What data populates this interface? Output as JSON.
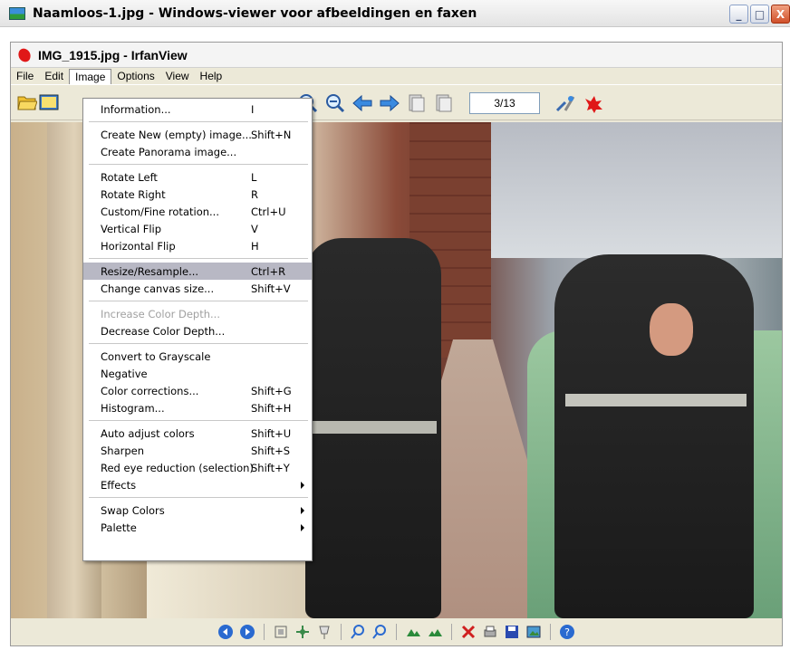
{
  "outer_window": {
    "title": "Naamloos-1.jpg - Windows-viewer voor afbeeldingen en faxen",
    "buttons": {
      "minimize": "_",
      "maximize": "□",
      "close": "X"
    }
  },
  "irfanview": {
    "title": "IMG_1915.jpg - IrfanView",
    "menu": [
      "File",
      "Edit",
      "Image",
      "Options",
      "View",
      "Help"
    ],
    "open_menu": "Image",
    "page_counter": "3/13"
  },
  "image_menu": {
    "groups": [
      [
        {
          "label": "Information...",
          "shortcut": "I"
        }
      ],
      [
        {
          "label": "Create New (empty) image...",
          "shortcut": "Shift+N"
        },
        {
          "label": "Create Panorama image...",
          "shortcut": ""
        }
      ],
      [
        {
          "label": "Rotate Left",
          "shortcut": "L"
        },
        {
          "label": "Rotate Right",
          "shortcut": "R"
        },
        {
          "label": "Custom/Fine rotation...",
          "shortcut": "Ctrl+U"
        },
        {
          "label": "Vertical Flip",
          "shortcut": "V"
        },
        {
          "label": "Horizontal Flip",
          "shortcut": "H"
        }
      ],
      [
        {
          "label": "Resize/Resample...",
          "shortcut": "Ctrl+R",
          "selected": true
        },
        {
          "label": "Change canvas size...",
          "shortcut": "Shift+V"
        }
      ],
      [
        {
          "label": "Increase Color Depth...",
          "shortcut": "",
          "disabled": true
        },
        {
          "label": "Decrease Color Depth...",
          "shortcut": ""
        }
      ],
      [
        {
          "label": "Convert to Grayscale",
          "shortcut": ""
        },
        {
          "label": "Negative",
          "shortcut": ""
        },
        {
          "label": "Color corrections...",
          "shortcut": "Shift+G"
        },
        {
          "label": "Histogram...",
          "shortcut": "Shift+H"
        }
      ],
      [
        {
          "label": "Auto adjust colors",
          "shortcut": "Shift+U"
        },
        {
          "label": "Sharpen",
          "shortcut": "Shift+S"
        },
        {
          "label": "Red eye reduction (selection)",
          "shortcut": "Shift+Y"
        },
        {
          "label": "Effects",
          "shortcut": "",
          "submenu": true
        }
      ],
      [
        {
          "label": "Swap Colors",
          "shortcut": "",
          "submenu": true
        },
        {
          "label": "Palette",
          "shortcut": "",
          "submenu": true
        }
      ]
    ]
  },
  "status_toolbar_icons": [
    "previous-icon",
    "next-icon",
    "fit-icon",
    "fullscreen-icon",
    "pin-icon",
    "zoom-in-icon",
    "zoom-out-icon",
    "rotate-left-icon",
    "rotate-right-icon",
    "delete-icon",
    "print-icon",
    "save-icon",
    "edit-icon",
    "help-icon"
  ]
}
